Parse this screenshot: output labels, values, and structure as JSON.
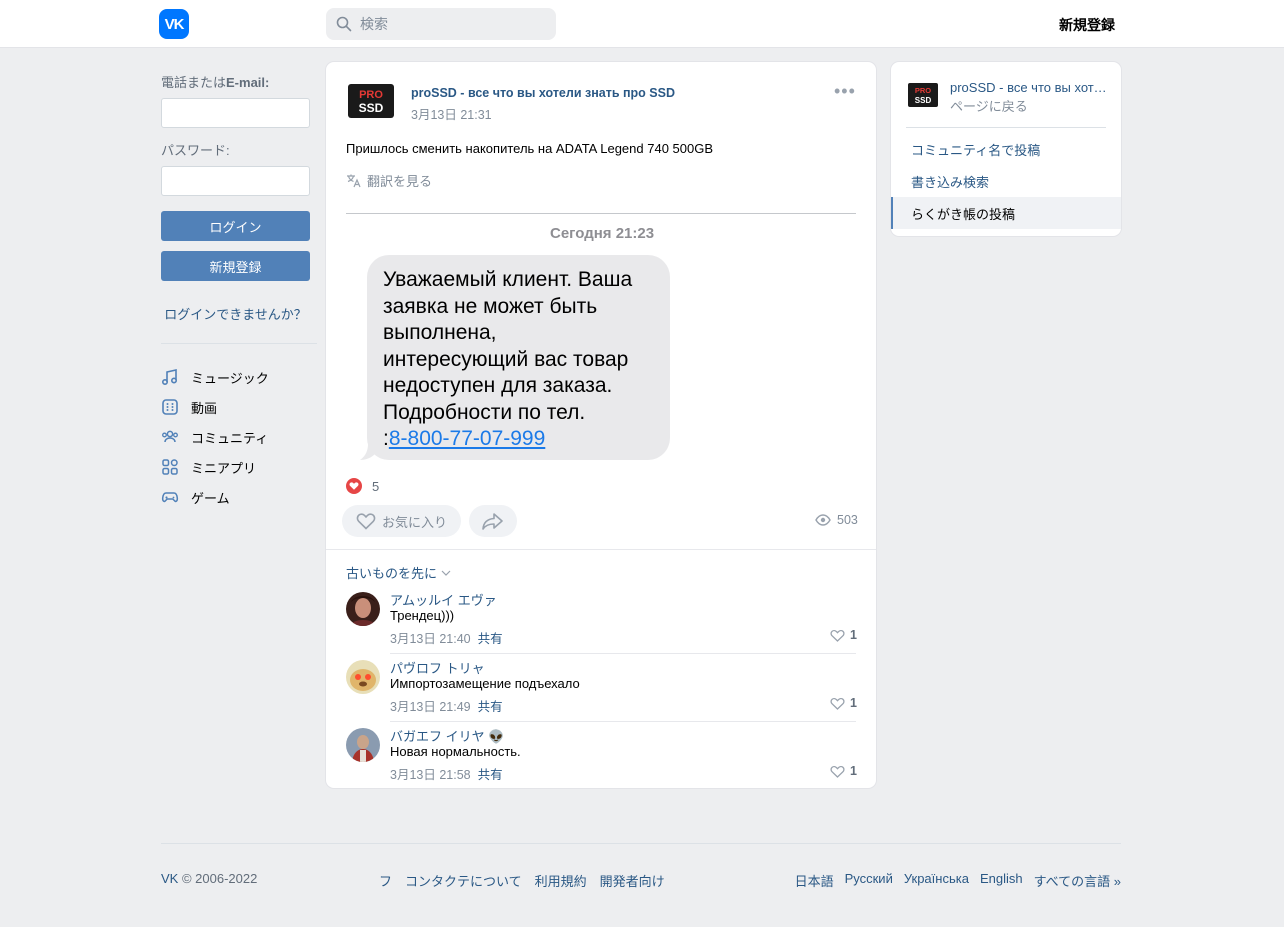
{
  "header": {
    "logo": "VK",
    "search_placeholder": "検索",
    "register": "新規登録"
  },
  "login": {
    "email_label_prefix": "電話または",
    "email_label_bold": "E-mail:",
    "password_label": "パスワード:",
    "login_button": "ログイン",
    "register_button": "新規登録",
    "forgot": "ログインできませんか？"
  },
  "menu": [
    {
      "label": "ミュージック",
      "icon": "music-icon"
    },
    {
      "label": "動画",
      "icon": "video-icon"
    },
    {
      "label": "コミュニティ",
      "icon": "community-icon"
    },
    {
      "label": "ミニアプリ",
      "icon": "apps-icon"
    },
    {
      "label": "ゲーム",
      "icon": "gamepad-icon"
    }
  ],
  "post": {
    "avatar_line1": "PRO",
    "avatar_line2": "SSD",
    "author": "proSSD - все что вы хотели знать про SSD",
    "date": "3月13日 21:31",
    "text": "Пришлось сменить накопитель на ADATA Legend 740 500GB",
    "translate": "翻訳を見る",
    "image": {
      "timestamp": "Сегодня 21:23",
      "message_lines": [
        "Уважаемый клиент. Ваша",
        "заявка  не может быть",
        "выполнена,",
        "интересующий вас товар",
        "недоступен для заказа.",
        "Подробности по тел."
      ],
      "phone_prefix": ":",
      "phone": "8-800-77-07-999"
    },
    "likes_count": "5",
    "like_button": "お気に入り",
    "views": "503"
  },
  "comments": {
    "sort_label": "古いものを先に",
    "items": [
      {
        "name": "アムッルイ エヴァ",
        "text": "Трендец)))",
        "date": "3月13日 21:40",
        "share": "共有",
        "likes": "1"
      },
      {
        "name": "パヴロフ トリャ",
        "text": "Импортозамещение подъехало",
        "date": "3月13日 21:49",
        "share": "共有",
        "likes": "1"
      },
      {
        "name": "バガエフ イリヤ 👽",
        "text": "Новая нормальность.",
        "date": "3月13日 21:58",
        "share": "共有",
        "likes": "1"
      }
    ]
  },
  "sidebar": {
    "name": "proSSD - все что вы хотели знать про SSD",
    "back": "ページに戻る",
    "links": [
      "コミュニティ名で投稿",
      "書き込み検索",
      "らくがき帳の投稿"
    ]
  },
  "footer": {
    "brand": "VK",
    "copyright": " © 2006-2022",
    "links": [
      "フ",
      "コンタクテについて",
      "利用規約",
      "開発者向け"
    ],
    "languages": [
      "日本語",
      "Русский",
      "Українська",
      "English",
      "すべての言語 »"
    ]
  }
}
